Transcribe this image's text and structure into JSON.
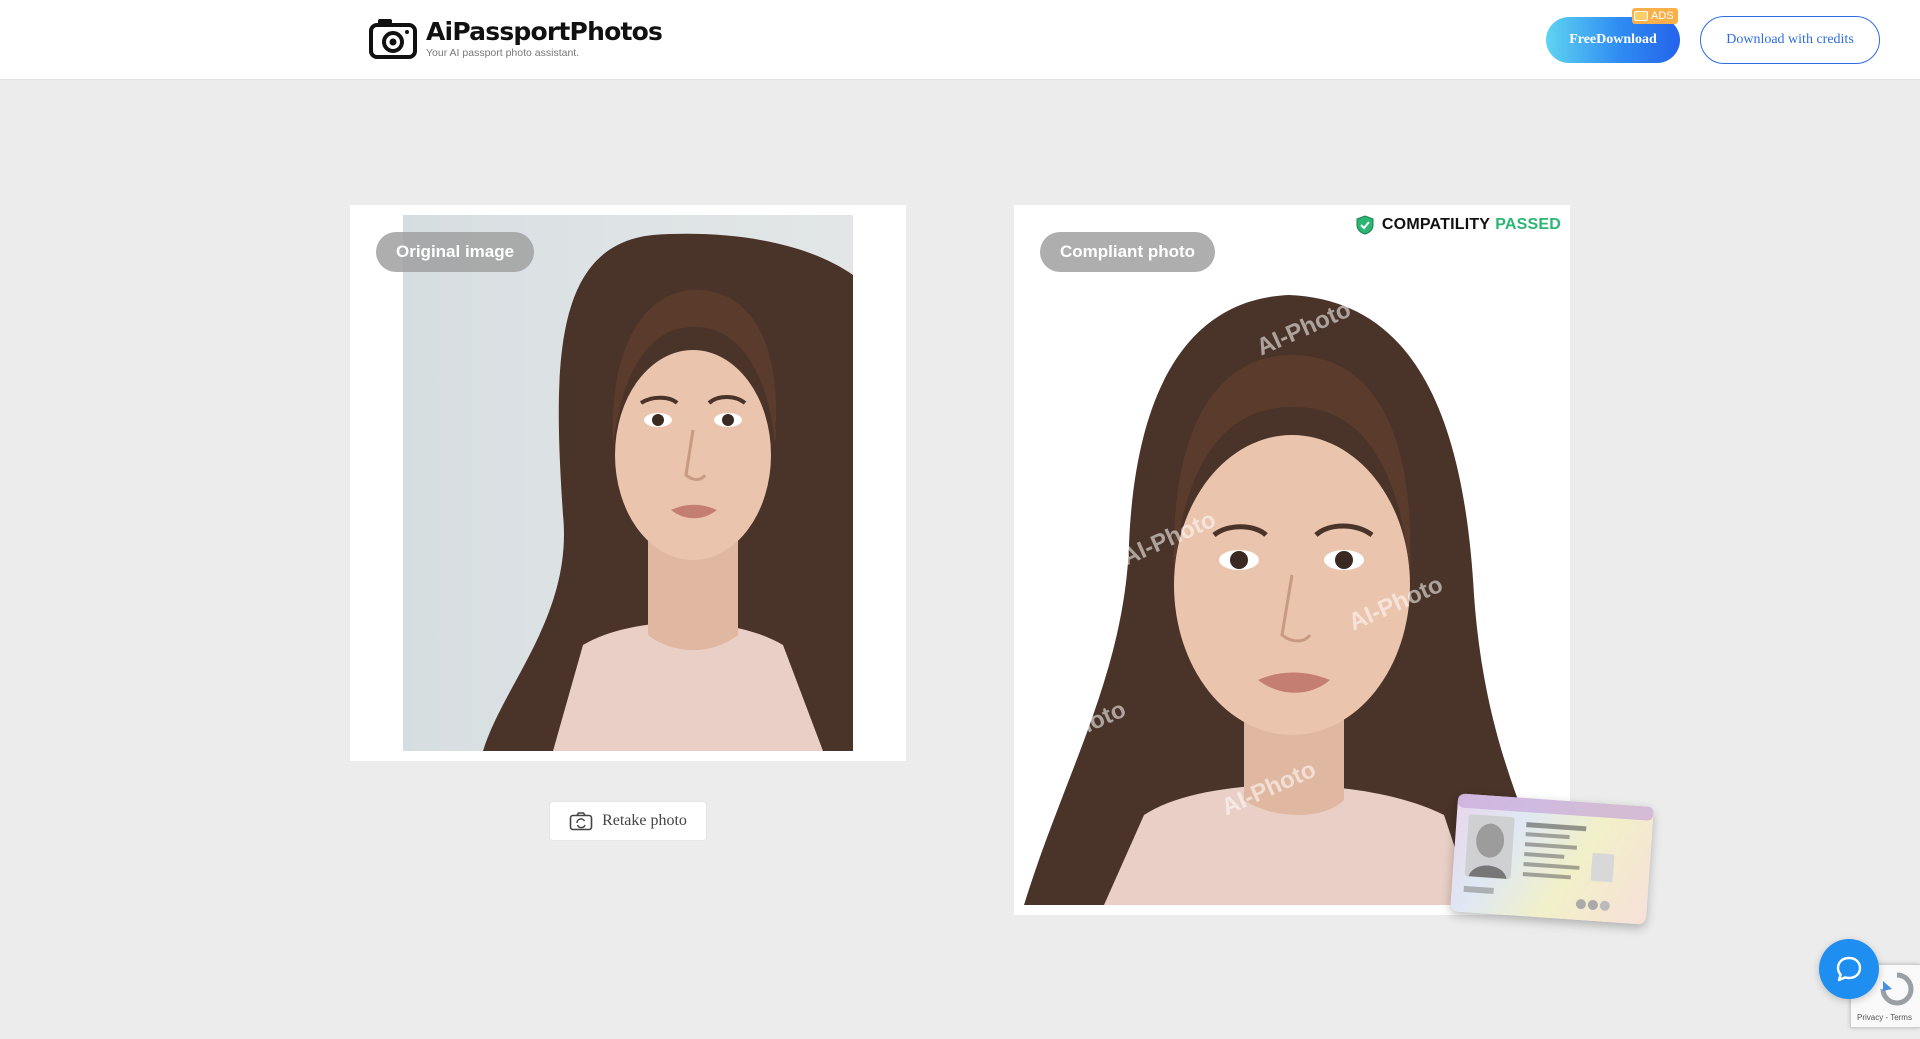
{
  "header": {
    "brand_name": "AiPassportPhotos",
    "brand_tagline": "Your AI passport photo assistant.",
    "free_download_label": "FreeDownload",
    "ads_badge": "ADS",
    "download_credits_label": "Download with credits"
  },
  "original": {
    "label": "Original image"
  },
  "compliant": {
    "label": "Compliant photo",
    "compat_label": "COMPATILITY",
    "compat_status": "PASSED",
    "watermark_text": "AI-Photo"
  },
  "actions": {
    "retake_label": "Retake photo"
  },
  "recaptcha": {
    "privacy_terms": "Privacy - Terms"
  },
  "colors": {
    "accent": "#2e6de0",
    "passed": "#2bb673",
    "chat": "#1f8ef1"
  },
  "icons": [
    "camera-logo-icon",
    "tv-icon",
    "shield-check-icon",
    "camera-rotate-icon",
    "chat-icon",
    "recaptcha-icon"
  ]
}
